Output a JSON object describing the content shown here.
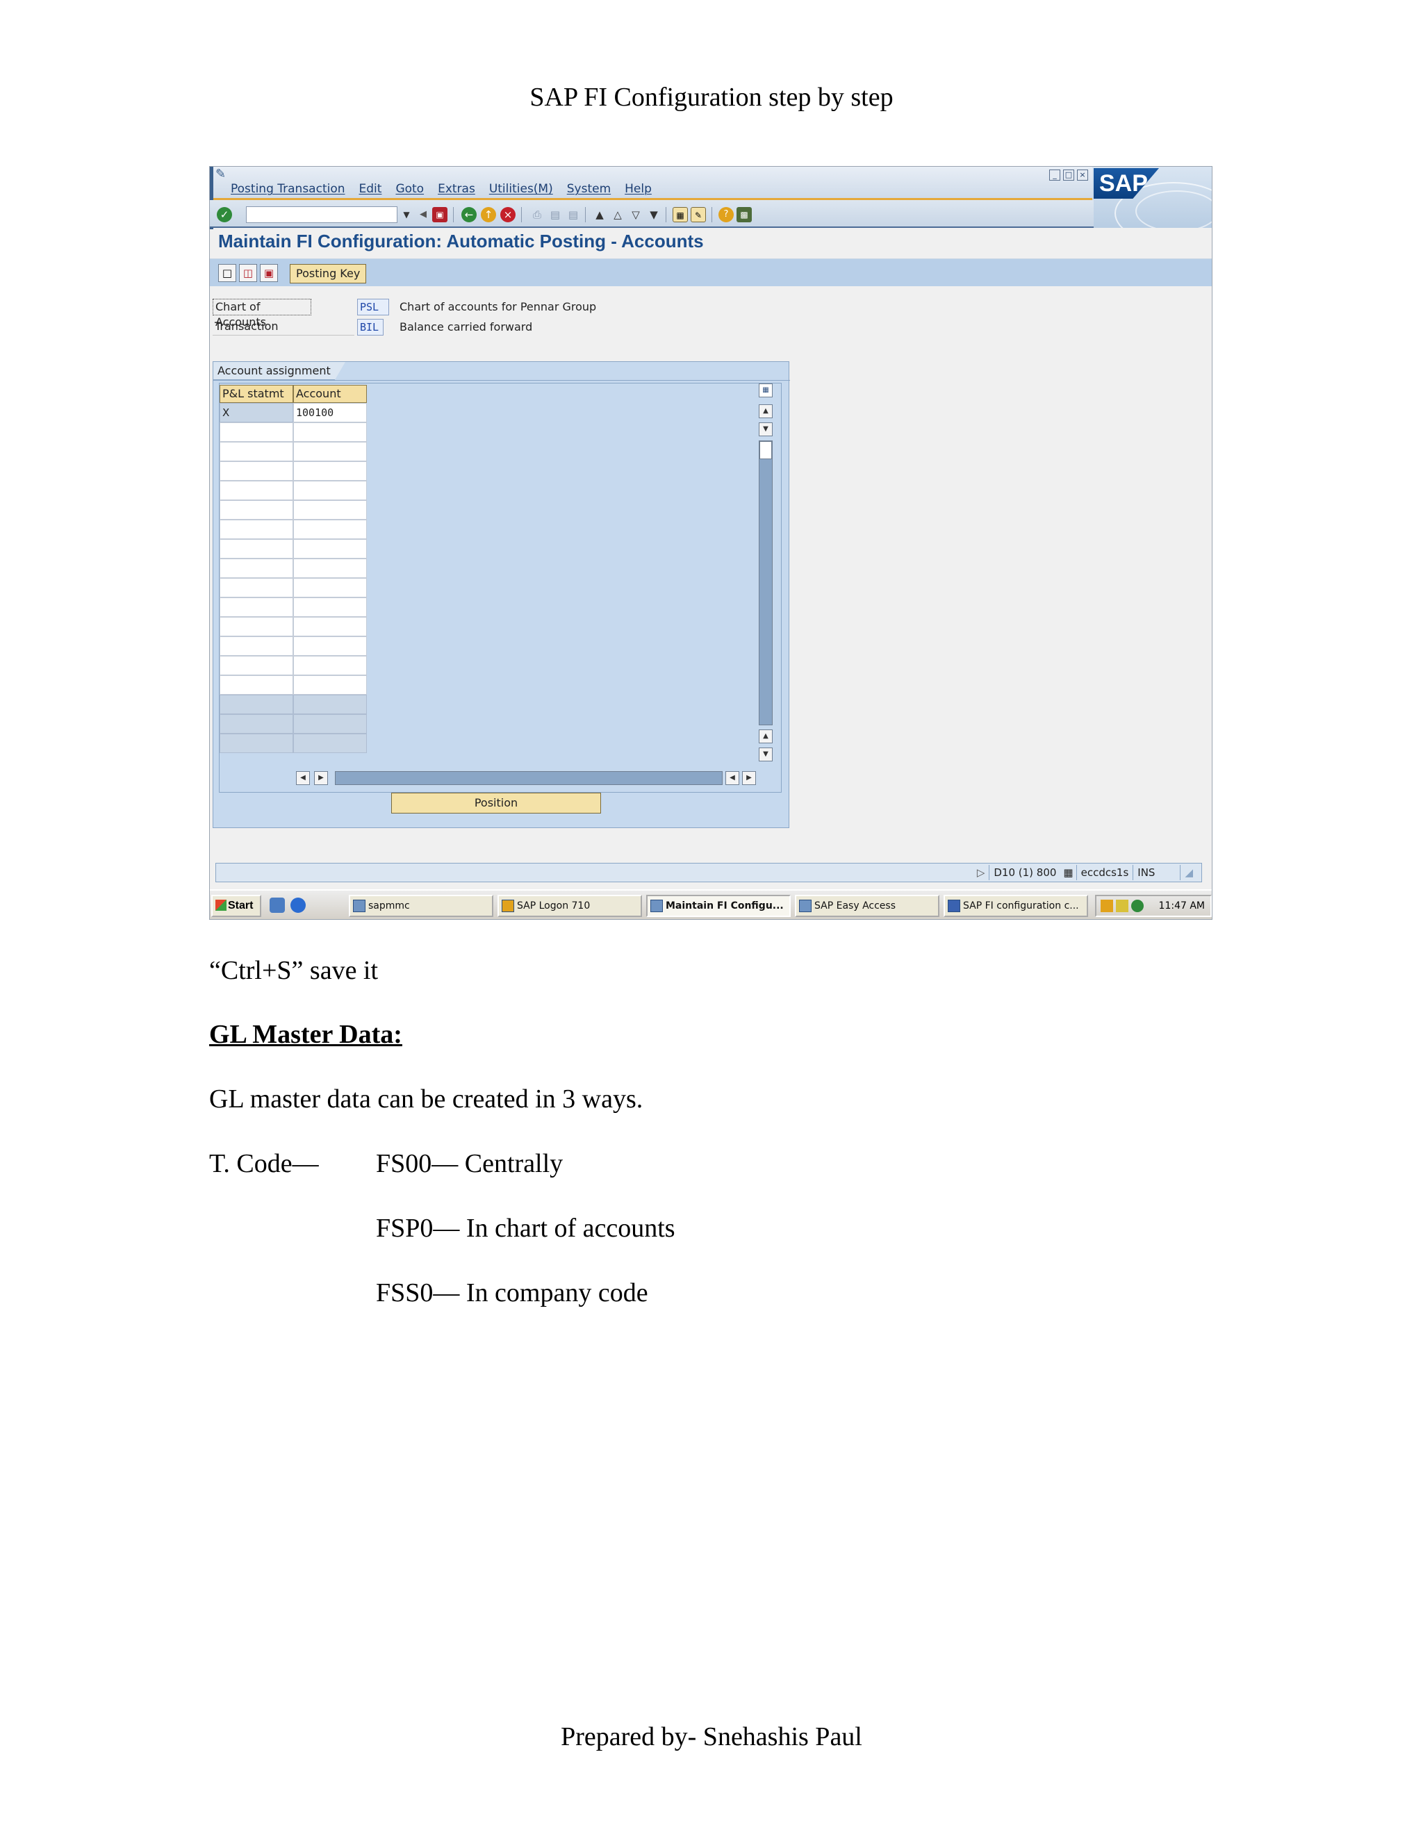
{
  "document": {
    "header": "SAP FI Configuration step by step",
    "footer": "Prepared by- Snehashis Paul"
  },
  "sap_window": {
    "menu": [
      "Posting Transaction",
      "Edit",
      "Goto",
      "Extras",
      "Utilities(M)",
      "System",
      "Help"
    ],
    "logo_text": "SAP",
    "screen_title": "Maintain FI Configuration: Automatic Posting - Accounts",
    "app_toolbar": {
      "posting_key_label": "Posting Key"
    },
    "fields": {
      "chart_of_accounts": {
        "label": "Chart of Accounts",
        "value": "PSL",
        "description": "Chart of accounts for Pennar Group"
      },
      "transaction": {
        "label": "Transaction",
        "value": "BIL",
        "description": "Balance carried forward"
      }
    },
    "account_assignment": {
      "title": "Account assignment",
      "columns": [
        "P&L statmt",
        "Account"
      ],
      "rows": [
        [
          "X",
          "100100"
        ]
      ]
    },
    "position_button": "Position",
    "status_bar": {
      "system": "D10 (1) 800",
      "server": "eccdcs1s",
      "mode": "INS"
    },
    "taskbar": {
      "start": "Start",
      "items": [
        "sapmmc",
        "SAP Logon 710",
        "Maintain FI Configu...",
        "SAP Easy Access",
        "SAP FI configuration c..."
      ],
      "clock": "11:47 AM"
    }
  },
  "body_text": {
    "save_note": "“Ctrl+S” save it",
    "heading": "GL Master Data:",
    "intro": "GL master data can be created in 3 ways.",
    "tcode_label": "T. Code—",
    "codes": [
      "FS00— Centrally",
      "FSP0— In chart of accounts",
      "FSS0— In company code"
    ]
  },
  "colors": {
    "sap_title_blue": "#1d4e8c",
    "sap_panel_blue": "#c6d9ee",
    "button_yellow": "#f4e2a8"
  }
}
